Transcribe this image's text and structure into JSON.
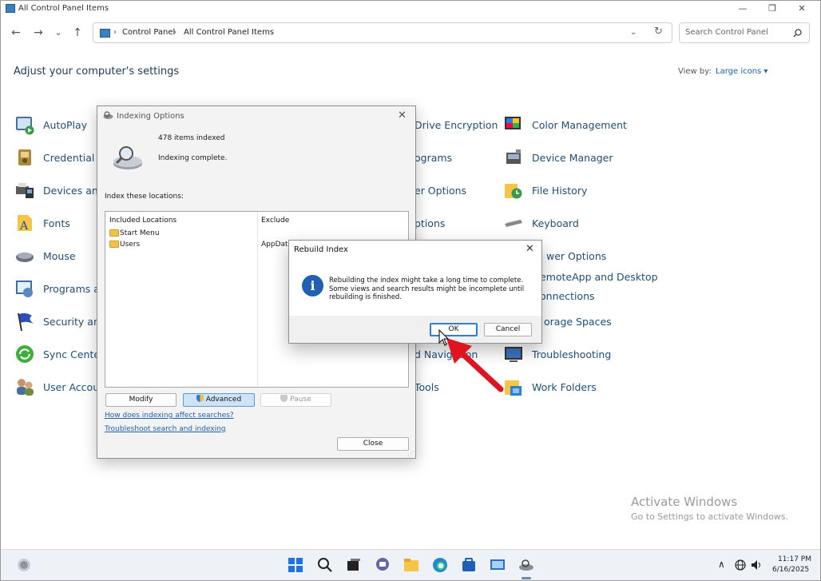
{
  "window": {
    "title": "All Control Panel Items"
  },
  "nav": {
    "back": "←",
    "forward": "→",
    "recent": "⌄",
    "up": "↑",
    "breadcrumb": [
      "Control Panel",
      "All Control Panel Items"
    ],
    "separator": "›",
    "dropdown": "⌄",
    "refresh": "↻",
    "search_placeholder": "Search Control Panel"
  },
  "header": {
    "title": "Adjust your computer's settings",
    "view_by_label": "View by:",
    "view_by_value": "Large icons ▾"
  },
  "items": {
    "col1": [
      "AutoPlay",
      "Credential M",
      "Devices and",
      "Fonts",
      "Mouse",
      "Programs ar",
      "Security and",
      "Sync Center",
      "User Accoun"
    ],
    "col2": [
      "Drive Encryption",
      "ograms",
      "er Options",
      "ptions",
      "wer Options",
      "emoteApp and Desktop",
      "onnections",
      "orage Spaces",
      "d Navigation",
      "Tools"
    ],
    "col3": [
      "Color Management",
      "Device Manager",
      "File History",
      "Keyboard",
      "Power Options",
      "RemoteApp and Desktop",
      "Connections",
      "Storage Spaces",
      "Troubleshooting",
      "Work Folders"
    ]
  },
  "indexing": {
    "title": "Indexing Options",
    "items_indexed": "478 items indexed",
    "status": "Indexing complete.",
    "locations_label": "Index these locations:",
    "col_included": "Included Locations",
    "col_exclude": "Exclude",
    "rows": [
      {
        "location": "Start Menu",
        "exclude": ""
      },
      {
        "location": "Users",
        "exclude": "AppData"
      }
    ],
    "btn_modify": "Modify",
    "btn_advanced": "Advanced",
    "btn_pause": "Pause",
    "link_affect": "How does indexing affect searches?",
    "link_troubleshoot": "Troubleshoot search and indexing",
    "btn_close": "Close"
  },
  "rebuild": {
    "title": "Rebuild Index",
    "message": "Rebuilding the index might take a long time to complete. Some views and search results might be incomplete until rebuilding is finished.",
    "ok": "OK",
    "cancel": "Cancel",
    "info_glyph": "i"
  },
  "watermark": {
    "line1": "Activate Windows",
    "line2": "Go to Settings to activate Windows."
  },
  "taskbar": {
    "time": "11:17 PM",
    "date": "6/16/2025",
    "chevron": "∧"
  },
  "colors": {
    "accent": "#1a5fb4",
    "arrow": "#e0141e"
  }
}
